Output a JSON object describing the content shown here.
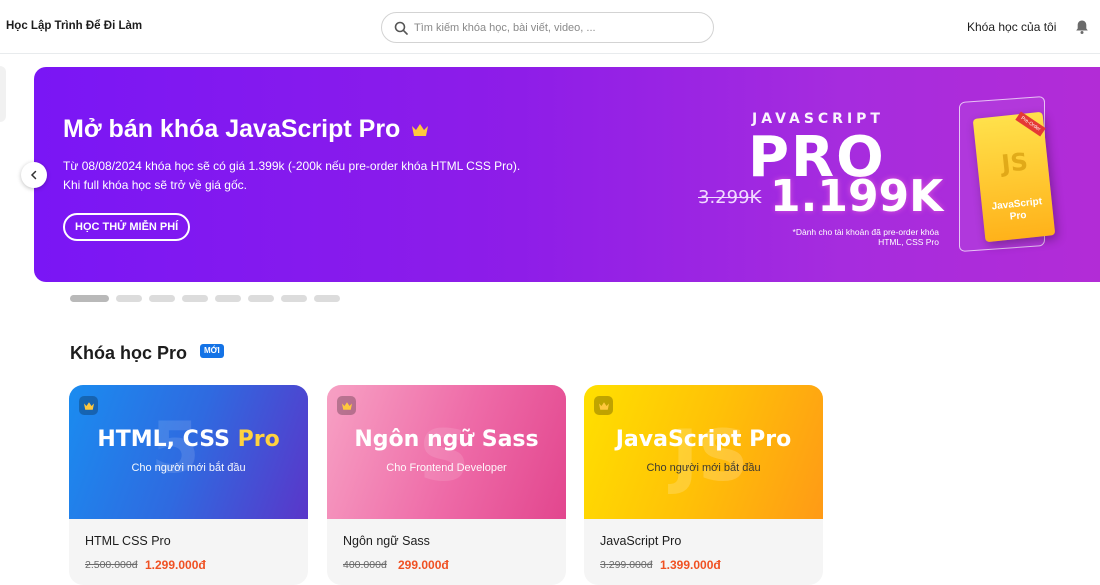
{
  "header": {
    "brand": "Học Lập Trình Để Đi Làm",
    "search_placeholder": "Tìm kiếm khóa học, bài viết, video, ...",
    "my_courses": "Khóa học của tôi"
  },
  "banner": {
    "title": "Mở bán khóa JavaScript Pro",
    "description": "Từ 08/08/2024 khóa học sẽ có giá 1.399k (-200k nếu pre-order khóa HTML CSS Pro). Khi full khóa học sẽ trở về giá gốc.",
    "cta": "HỌC THỬ MIỄN PHÍ",
    "promo": {
      "brand": "JAVASCRIPT",
      "pro": "PRO",
      "old_price": "3.299K",
      "new_price": "1.199K",
      "note": "*Dành cho tài khoản đã pre-order khóa HTML, CSS Pro",
      "book_name": "JavaScript Pro",
      "book_mark": "JS",
      "ribbon": "Pre-Order"
    },
    "slide_count": 8,
    "active_slide": 0
  },
  "section": {
    "title": "Khóa học Pro",
    "badge": "MỚI"
  },
  "courses": [
    {
      "thumb_title": "HTML, CSS",
      "thumb_pro": "Pro",
      "thumb_sub": "Cho người mới bắt đầu",
      "name": "HTML CSS Pro",
      "old_price": "2.500.000đ",
      "price": "1.299.000đ",
      "gradient": [
        "#1e88e5",
        "#5e35b1"
      ]
    },
    {
      "thumb_title": "Ngôn ngữ Sass",
      "thumb_pro": "",
      "thumb_sub": "Cho Frontend Developer",
      "name": "Ngôn ngữ Sass",
      "old_price": "400.000đ",
      "price": "299.000đ",
      "gradient": [
        "#f48fb1",
        "#e64a8f"
      ]
    },
    {
      "thumb_title": "JavaScript",
      "thumb_pro": "Pro",
      "thumb_sub": "Cho người mới bắt đầu",
      "name": "JavaScript Pro",
      "old_price": "3.299.000đ",
      "price": "1.399.000đ",
      "gradient": [
        "#ffd600",
        "#ff9800"
      ]
    }
  ],
  "colors": {
    "accent": "#f05123",
    "banner_start": "#7a16f5",
    "banner_end": "#b32cd6",
    "badge": "#1473e6"
  }
}
